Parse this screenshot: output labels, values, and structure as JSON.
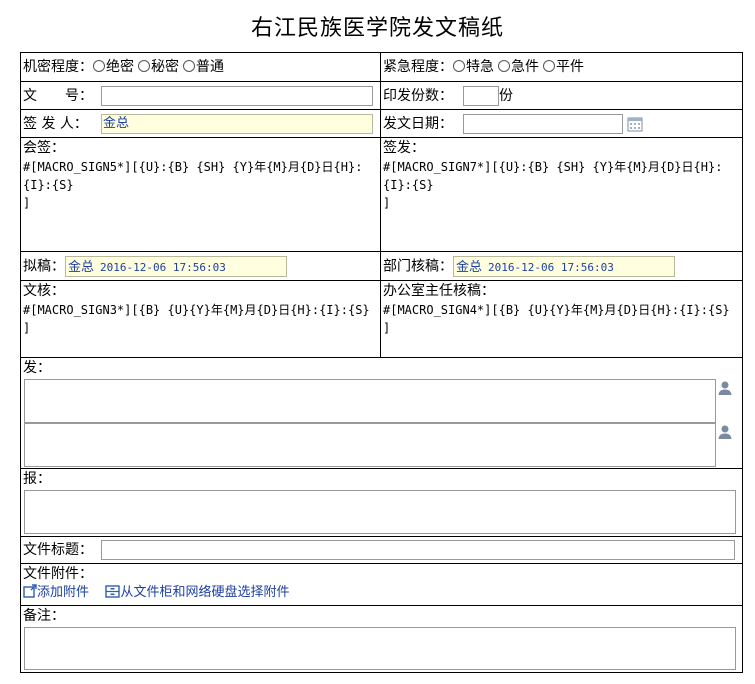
{
  "title": "右江民族医学院发文稿纸",
  "secrecy": {
    "label": "机密程度：",
    "options": [
      "绝密",
      "秘密",
      "普通"
    ]
  },
  "urgency": {
    "label": "紧急程度：",
    "options": [
      "特急",
      "急件",
      "平件"
    ]
  },
  "doc_number": {
    "label": "文　　号："
  },
  "copies": {
    "label": "印发份数：",
    "unit": "份"
  },
  "signer": {
    "label": "签 发 人：",
    "value": "金总"
  },
  "issue_date": {
    "label": "发文日期："
  },
  "countersign": {
    "label": "会签：",
    "macro": "#[MACRO_SIGN5*][{U}:{B} {SH} {Y}年{M}月{D}日{H}:{I}:{S}\n]"
  },
  "sign_issue": {
    "label": "签发：",
    "macro": "#[MACRO_SIGN7*][{U}:{B} {SH} {Y}年{M}月{D}日{H}:{I}:{S}\n]"
  },
  "draft": {
    "label": "拟稿：",
    "name": "金总",
    "time": "2016-12-06 17:56:03"
  },
  "dept_review": {
    "label": "部门核稿：",
    "name": "金总",
    "time": "2016-12-06 17:56:03"
  },
  "text_review": {
    "label": "文核：",
    "macro": "#[MACRO_SIGN3*][{B} {U}{Y}年{M}月{D}日{H}:{I}:{S}\n]"
  },
  "office_review": {
    "label": "办公室主任核稿：",
    "macro": "#[MACRO_SIGN4*][{B} {U}{Y}年{M}月{D}日{H}:{I}:{S}\n]"
  },
  "send": {
    "label": "发："
  },
  "report": {
    "label": "报："
  },
  "doc_title": {
    "label": "文件标题："
  },
  "attachments": {
    "label": "文件附件：",
    "add_label": "添加附件",
    "select_label": "从文件柜和网络硬盘选择附件"
  },
  "remarks": {
    "label": "备注："
  },
  "colors": {
    "link": "#1c3fa3",
    "highlight": "#ffffe0"
  }
}
